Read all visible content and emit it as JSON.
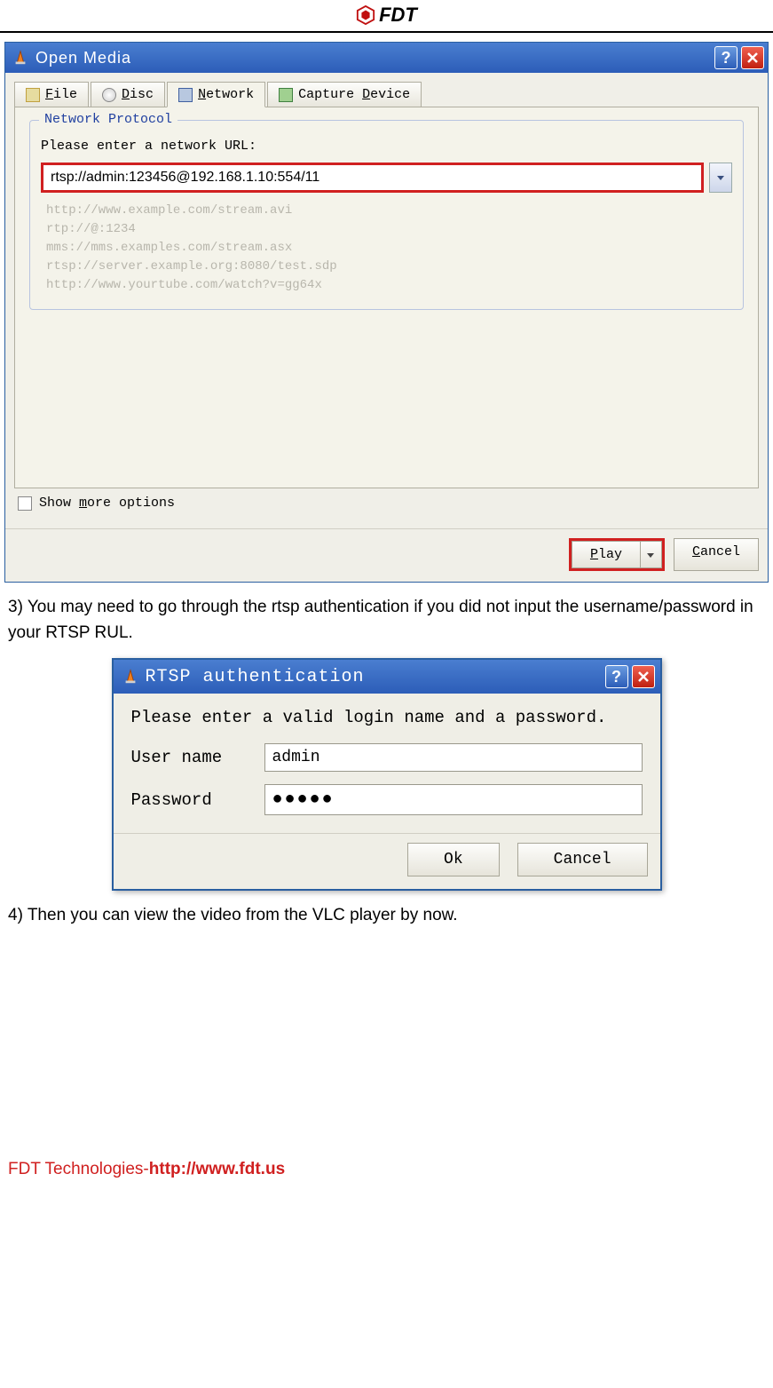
{
  "header": {
    "brand": "FDT"
  },
  "open_media": {
    "title": "Open Media",
    "tabs": {
      "file": "File",
      "disc": "Disc",
      "network": "Network",
      "capture": "Capture Device"
    },
    "group_label": "Network Protocol",
    "prompt": "Please enter a network URL:",
    "url_value": "rtsp://admin:123456@192.168.1.10:554/11",
    "examples": [
      "http://www.example.com/stream.avi",
      "rtp://@:1234",
      "mms://mms.examples.com/stream.asx",
      "rtsp://server.example.org:8080/test.sdp",
      "http://www.yourtube.com/watch?v=gg64x"
    ],
    "show_more": "Show more options",
    "play": "Play",
    "cancel": "Cancel"
  },
  "doc": {
    "step3": "3) You may need to go through the rtsp authentication if you did not input the username/password in your RTSP RUL.",
    "step4": "4) Then you can view the video from the VLC player by now."
  },
  "auth": {
    "title": "RTSP authentication",
    "prompt": "Please enter a valid login name and a password.",
    "user_label": "User name",
    "user_value": "admin",
    "pass_label": "Password",
    "pass_value": "●●●●●",
    "ok": "Ok",
    "cancel": "Cancel"
  },
  "footer": {
    "company": "FDT Technologies-",
    "url": "http://www.fdt.us"
  }
}
